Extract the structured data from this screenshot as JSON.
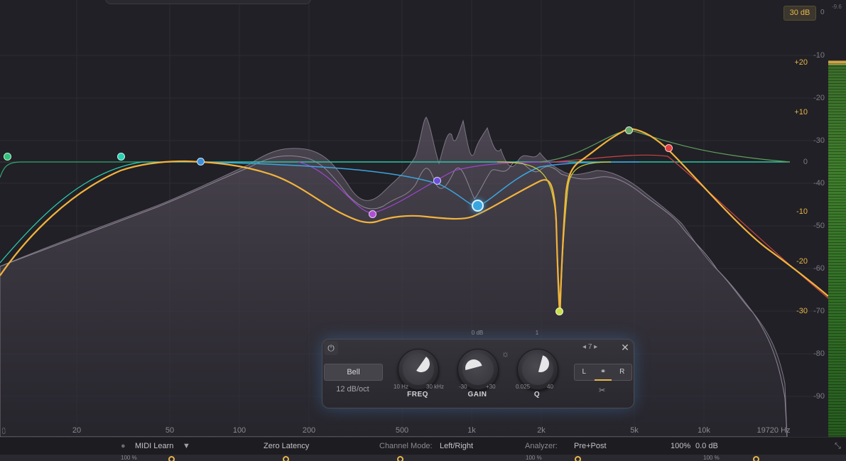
{
  "range": {
    "label": "30 dB"
  },
  "meter": {
    "peak_label": "-9.6",
    "zero_label": "0"
  },
  "db_scale": [
    "-10",
    "-20",
    "-30",
    "0",
    "-40",
    "-50",
    "-60",
    "-70",
    "-80",
    "-90"
  ],
  "gain_scale": [
    "+20",
    "+10",
    "-10",
    "-20",
    "-30"
  ],
  "gain_zero": "0",
  "freq_axis": [
    "20",
    "50",
    "100",
    "200",
    "500",
    "1k",
    "2k",
    "5k",
    "10k",
    "19720 Hz"
  ],
  "panel": {
    "shape": "Bell",
    "slope": "12 dB/oct",
    "freq": {
      "name": "FREQ",
      "min": "10 Hz",
      "max": "30 kHz",
      "top": ""
    },
    "gain": {
      "name": "GAIN",
      "min": "-30",
      "max": "+30",
      "top": "0 dB"
    },
    "q": {
      "name": "Q",
      "min": "0.025",
      "max": "40",
      "top": "1"
    },
    "band_number": "7",
    "left": "L",
    "right": "R"
  },
  "bottom": {
    "midi": "MIDI Learn",
    "latency": "Zero Latency",
    "channel_label": "Channel Mode:",
    "channel_value": "Left/Right",
    "analyzer_label": "Analyzer:",
    "analyzer_value": "Pre+Post",
    "zoom": "100%",
    "output": "0.0 dB"
  },
  "strip": {
    "left_value": "100 %",
    "mid_value": "100 %",
    "right_value": "100 %"
  },
  "colors": {
    "accent": "#e8b64a",
    "selected_band": "#3aa6e0",
    "curve": "#f2b33d"
  }
}
